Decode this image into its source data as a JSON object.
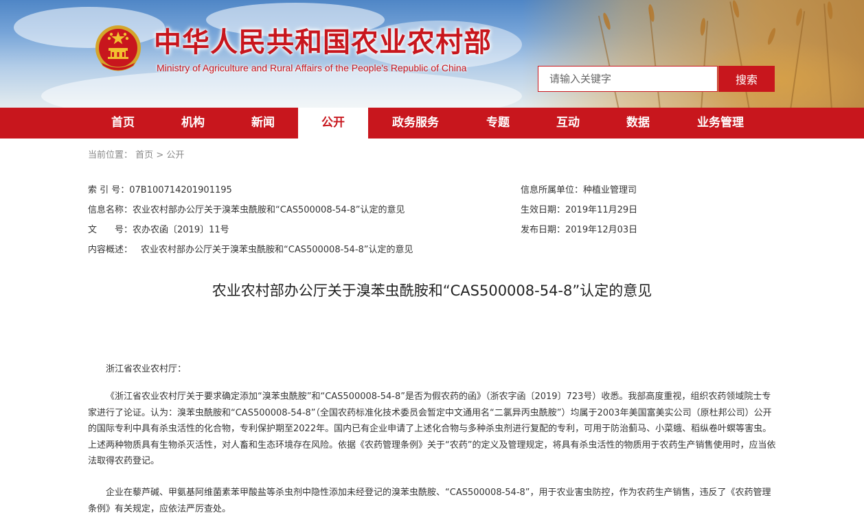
{
  "header": {
    "title": "中华人民共和国农业农村部",
    "subtitle": "Ministry of Agriculture and Rural Affairs of the People's Republic of China",
    "emblem_icon": "national-emblem-icon",
    "search": {
      "placeholder": "请输入关键字",
      "button_label": "搜索"
    }
  },
  "colors": {
    "brand_red": "#c8161d",
    "nav_active_bg": "#ffffff"
  },
  "nav": {
    "items": [
      {
        "label": "首页"
      },
      {
        "label": "机构"
      },
      {
        "label": "新闻"
      },
      {
        "label": "公开",
        "active": true
      },
      {
        "label": "政务服务"
      },
      {
        "label": "专题"
      },
      {
        "label": "互动"
      },
      {
        "label": "数据"
      },
      {
        "label": "业务管理"
      }
    ]
  },
  "breadcrumb": {
    "prefix": "当前位置：",
    "home": "首页",
    "separator": ">",
    "current": "公开"
  },
  "meta": {
    "index_label": "索 引 号：",
    "index_value": "07B100714201901195",
    "name_label": "信息名称：",
    "name_value": "农业农村部办公厅关于溴苯虫酰胺和“CAS500008-54-8”认定的意见",
    "docno_label": "文　　号：",
    "docno_value": "农办农函〔2019〕11号",
    "summary_label": "内容概述：",
    "summary_value": "农业农村部办公厅关于溴苯虫酰胺和“CAS500008-54-8”认定的意见",
    "unit_label": "信息所属单位：",
    "unit_value": "种植业管理司",
    "effective_label": "生效日期：",
    "effective_value": "2019年11月29日",
    "published_label": "发布日期：",
    "published_value": "2019年12月03日"
  },
  "article": {
    "title": "农业农村部办公厅关于溴苯虫酰胺和“CAS500008-54-8”认定的意见",
    "salutation": "浙江省农业农村厅：",
    "paragraphs": [
      "《浙江省农业农村厅关于要求确定添加“溴苯虫酰胺”和“CAS500008-54-8”是否为假农药的函》（浙农字函〔2019〕723号）收悉。我部高度重视，组织农药领域院士专家进行了论证。认为：溴苯虫酰胺和“CAS500008-54-8”（全国农药标准化技术委员会暂定中文通用名“二氯异丙虫酰胺”）均属于2003年美国富美实公司（原杜邦公司）公开的国际专利中具有杀虫活性的化合物，专利保护期至2022年。国内已有企业申请了上述化合物与多种杀虫剂进行复配的专利，可用于防治蓟马、小菜蛾、稻纵卷叶螟等害虫。上述两种物质具有生物杀灭活性，对人畜和生态环境存在风险。依据《农药管理条例》关于“农药”的定义及管理规定，将具有杀虫活性的物质用于农药生产销售使用时，应当依法取得农药登记。",
      "企业在藜芦碱、甲氨基阿维菌素苯甲酸盐等杀虫剂中隐性添加未经登记的溴苯虫酰胺、“CAS500008-54-8”，用于农业害虫防控，作为农药生产销售，违反了《农药管理条例》有关规定，应依法严厉查处。"
    ]
  }
}
